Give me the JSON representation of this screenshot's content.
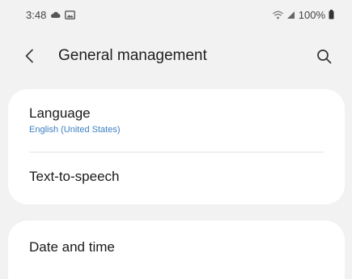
{
  "status_bar": {
    "time": "3:48",
    "battery": "100%"
  },
  "header": {
    "title": "General management"
  },
  "settings": {
    "language": {
      "title": "Language",
      "value": "English (United States)"
    },
    "text_to_speech": {
      "title": "Text-to-speech"
    },
    "date_and_time": {
      "title": "Date and time"
    }
  },
  "colors": {
    "background": "#f2f2f2",
    "card": "#ffffff",
    "accent_subtitle": "#3b7fc4"
  },
  "icons": {
    "back": "chevron-left-icon",
    "search": "search-icon",
    "cloud": "cloud-icon",
    "image": "image-icon",
    "wifi": "wifi-icon",
    "signal": "signal-icon",
    "battery": "battery-icon"
  }
}
